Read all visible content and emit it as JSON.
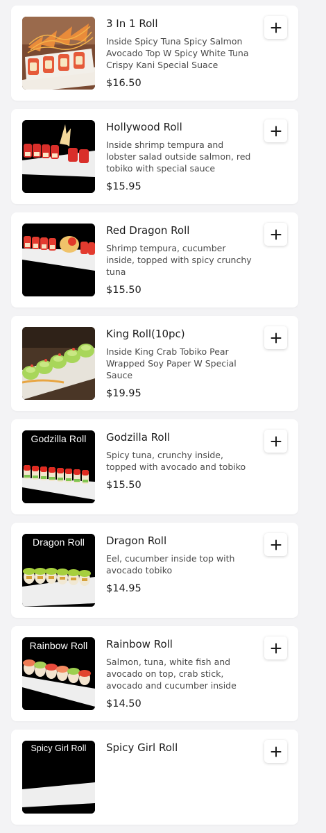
{
  "items": [
    {
      "name": "3 In 1 Roll",
      "description": "Inside Spicy Tuna Spicy Salmon Avocado Top W Spicy White Tuna Crispy Kani Special Suace",
      "price": "$16.50",
      "image_caption": ""
    },
    {
      "name": "Hollywood Roll",
      "description": "Inside shrimp tempura and lobster salad outside salmon, red tobiko with special sauce",
      "price": "$15.95",
      "image_caption": ""
    },
    {
      "name": "Red Dragon Roll",
      "description": "Shrimp tempura, cucumber inside, topped with spicy crunchy tuna",
      "price": "$15.50",
      "image_caption": ""
    },
    {
      "name": "King Roll(10pc)",
      "description": "Inside King Crab Tobiko Pear Wrapped Soy Paper W Special Sauce",
      "price": "$19.95",
      "image_caption": ""
    },
    {
      "name": "Godzilla Roll",
      "description": "Spicy tuna, crunchy inside, topped with avocado and tobiko",
      "price": "$15.50",
      "image_caption": "Godzilla Roll"
    },
    {
      "name": "Dragon Roll",
      "description": "Eel, cucumber inside top with avocado tobiko",
      "price": "$14.95",
      "image_caption": "Dragon Roll"
    },
    {
      "name": "Rainbow Roll",
      "description": "Salmon, tuna, white fish and avocado on top, crab stick, avocado and cucumber inside",
      "price": "$14.50",
      "image_caption": "Rainbow Roll"
    },
    {
      "name": "Spicy Girl Roll",
      "description": "",
      "price": "",
      "image_caption": "Spicy Girl Roll"
    }
  ],
  "icons": {
    "add": "plus-icon"
  },
  "colors": {
    "background": "#f3f3f5",
    "card": "#ffffff",
    "text": "#1c1c1c",
    "muted": "#4a4a4a"
  }
}
